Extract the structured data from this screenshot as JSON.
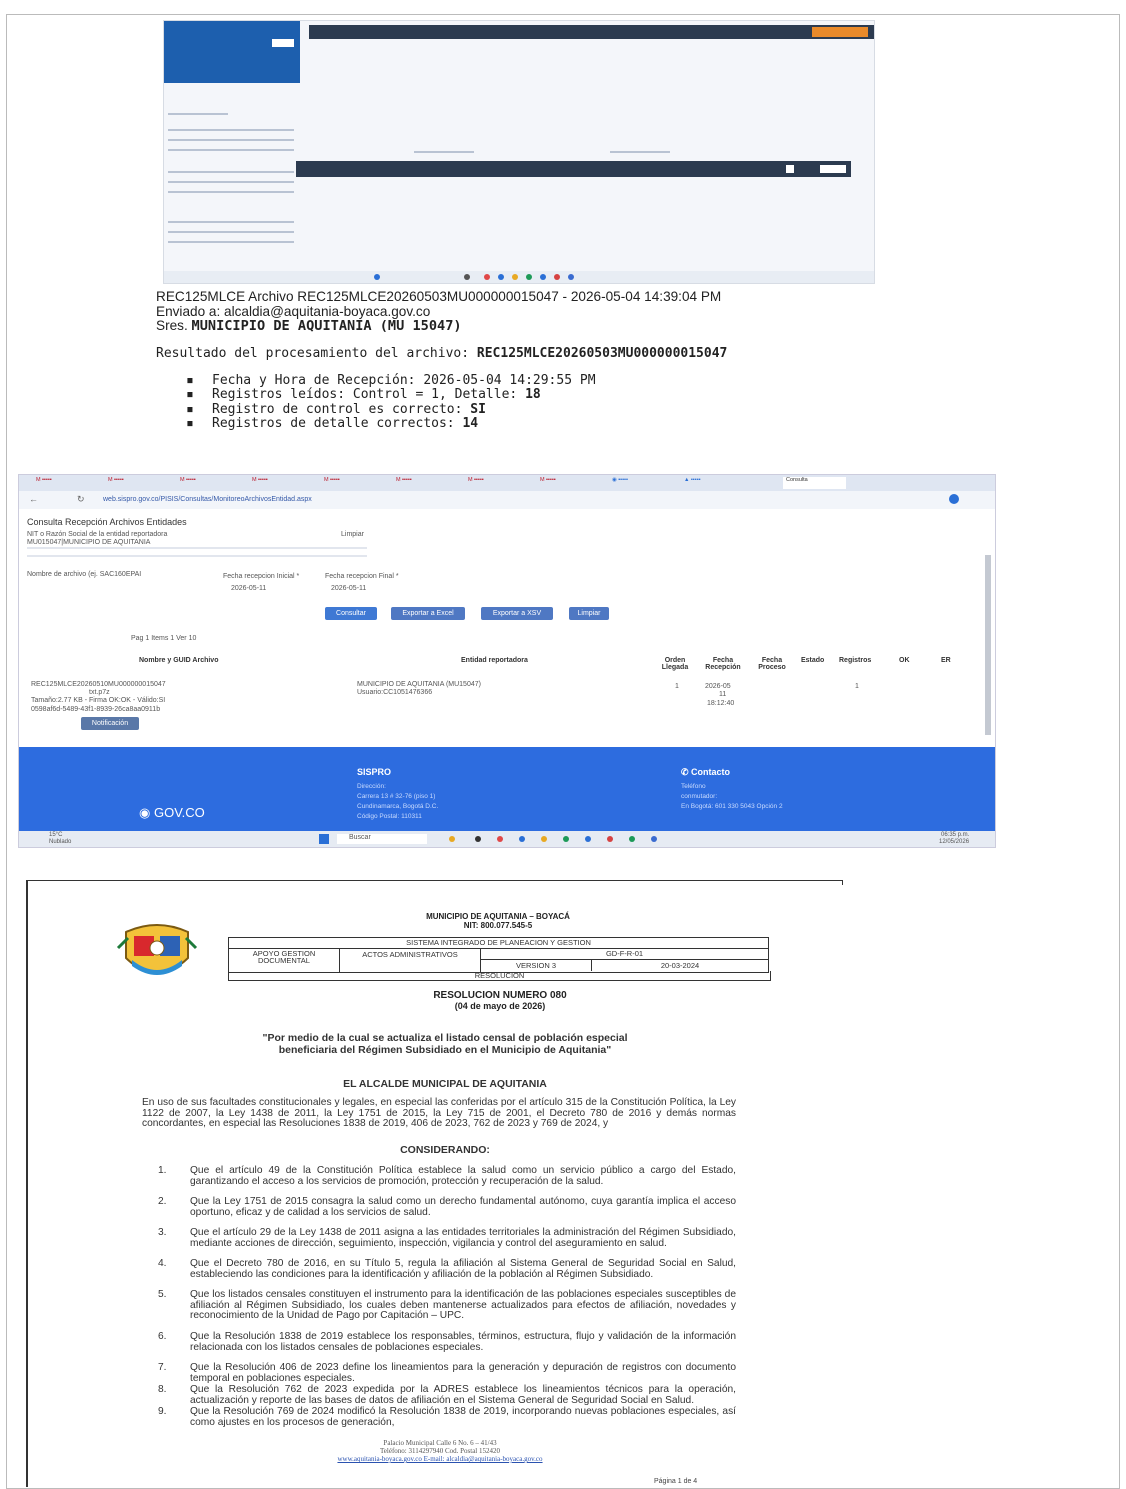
{
  "caption": {
    "line1": "REC125MLCE Archivo REC125MLCE20260503MU000000015047 - 2026-05-04 14:39:04 PM",
    "line2": "Enviado a: alcaldia@aquitania-boyaca.gov.co",
    "sres_label": "Sres.",
    "sres_value": "MUNICIPIO DE AQUITANIA (MU 15047)",
    "result_label": "Resultado del procesamiento del archivo:",
    "result_value": "REC125MLCE20260503MU000000015047",
    "bullets": [
      {
        "label": "Fecha y Hora de Recepción:",
        "value": "2026-05-04 14:29:55 PM"
      },
      {
        "label": "Registros leídos: Control = 1, Detalle:",
        "value": "18"
      },
      {
        "label": "Registro de control es correcto:",
        "value": "SI"
      },
      {
        "label": "Registros de detalle correctos:",
        "value": "14"
      }
    ]
  },
  "portal": {
    "url": "web.sispro.gov.co/PISIS/Consultas/MonitoreoArchivosEntidad.aspx",
    "tab_consulta": "Consulta",
    "title": "Consulta Recepción Archivos Entidades",
    "nit_label": "NIT o Razón Social de la entidad reportadora",
    "nit_value": "MU015047|MUNICIPIO DE AQUITANIA",
    "limpiar_link": "Limpiar",
    "filename_label": "Nombre de archivo (ej. SAC160EPAI",
    "fecha_inicial_label": "Fecha recepcion Inicial *",
    "fecha_final_label": "Fecha recepcion Final *",
    "fecha_inicial": "2026-05-11",
    "fecha_final": "2026-05-11",
    "buttons": {
      "consultar": "Consultar",
      "excel": "Exportar a Excel",
      "xsv": "Exportar a XSV",
      "limpiar": "Limpiar"
    },
    "pager": "Pag  1   Items 1 Ver   10",
    "columns": [
      "Nombre y GUID Archivo",
      "Entidad reportadora",
      "Orden Llegada",
      "Fecha Recepción",
      "Fecha Proceso",
      "Estado",
      "Registros",
      "OK",
      "ER"
    ],
    "row": {
      "file": "REC125MLCE20260510MU000000015047",
      "file_ext": "txt.p7z",
      "size": "Tamaño:2.77 KB - Firma OK:OK - Válido:SI",
      "guid": "0598af6d-5489-43f1-8939-26ca8aa0911b",
      "entity": "MUNICIPIO DE AQUITANIA (MU15047)",
      "user": "Usuario:CC1051476366",
      "order": "1",
      "date": "2026-05",
      "date2": "11",
      "time": "18:12:40",
      "registros": "1",
      "notif_button": "Notificación"
    },
    "footer": {
      "brand": "GOV.CO",
      "sispro": "SISPRO",
      "contacto": "Contacto",
      "dir_label": "Dirección:",
      "dir_value": "Carrera 13 # 32-76 (piso 1)",
      "city": "Cundinamarca, Bogotá D.C.",
      "postal": "Código Postal: 110311",
      "tel_label": "Teléfono",
      "conm": "conmutador:",
      "bog": "En Bogotá: 601 330 5043 Opción 2"
    },
    "weather": "15°C",
    "weather_desc": "Nublado",
    "search": "Buscar",
    "clock_time": "06:35 p.m.",
    "clock_date": "12/05/2026"
  },
  "doc": {
    "municipio": "MUNICIPIO DE AQUITANIA – BOYACÁ",
    "nit": "NIT: 800.077.545-5",
    "sistema": "SISTEMA INTEGRADO DE PLANEACION Y GESTION",
    "cell_apoyo": "APOYO GESTION DOCUMENTAL",
    "cell_actos": "ACTOS ADMINISTRATIVOS",
    "cell_code": "GD-F-R-01",
    "cell_version": "VERSION 3",
    "cell_date": "20-03-2024",
    "cell_resolucion": "RESOLUCION",
    "res_number": "RESOLUCION NUMERO  080",
    "res_date": "(04 de mayo de 2026)",
    "subject1": "\"Por medio de la cual se actualiza el listado censal de población especial",
    "subject2": "beneficiaria del Régimen Subsidiado en el Municipio de Aquitania\"",
    "alcalde": "EL ALCALDE MUNICIPAL DE AQUITANIA",
    "intro": "En uso de sus facultades constitucionales y legales, en especial las conferidas por el artículo 315 de la Constitución Política, la Ley 1122 de 2007, la Ley 1438 de 2011, la Ley 1751 de 2015, la Ley 715 de 2001, el Decreto 780 de 2016 y demás normas concordantes, en especial las Resoluciones 1838 de 2019, 406 de 2023, 762 de 2023 y 769 de 2024, y",
    "considerando": "CONSIDERANDO:",
    "items": [
      {
        "n": "1.",
        "t": "Que el artículo 49 de la Constitución Política establece la salud como un servicio público a cargo del Estado, garantizando el acceso a los servicios de promoción, protección y recuperación de la salud."
      },
      {
        "n": "2.",
        "t": "Que la Ley 1751 de 2015 consagra la salud como un derecho fundamental autónomo, cuya garantía implica el acceso oportuno, eficaz y de calidad a los servicios de salud."
      },
      {
        "n": "3.",
        "t": "Que el artículo 29 de la Ley 1438 de 2011 asigna a las entidades territoriales la administración del Régimen Subsidiado, mediante acciones de dirección, seguimiento, inspección, vigilancia y control del aseguramiento en salud."
      },
      {
        "n": "4.",
        "t": "Que el Decreto 780 de 2016, en su Título 5, regula la afiliación al Sistema General de Seguridad Social en Salud, estableciendo las condiciones para la identificación y afiliación de la población al Régimen Subsidiado."
      },
      {
        "n": "5.",
        "t": "Que los listados censales constituyen el instrumento para la identificación de las poblaciones especiales susceptibles de afiliación al Régimen Subsidiado, los cuales deben mantenerse actualizados para efectos de afiliación, novedades y reconocimiento de la Unidad de Pago por Capitación – UPC."
      },
      {
        "n": "6.",
        "t": "Que la Resolución 1838 de 2019 establece los responsables, términos, estructura, flujo y validación de la información relacionada con los listados censales de poblaciones especiales."
      },
      {
        "n": "7.",
        "t": "Que la Resolución 406 de 2023 define los lineamientos para la generación y depuración de registros con documento temporal en poblaciones especiales."
      },
      {
        "n": "8.",
        "t": "Que la Resolución 762 de 2023 expedida por la ADRES establece los lineamientos técnicos para la operación, actualización y reporte de las bases de datos de afiliación en el Sistema General de Seguridad Social en Salud."
      },
      {
        "n": "9.",
        "t": "Que la Resolución 769 de 2024 modificó la Resolución 1838 de 2019, incorporando nuevas poblaciones especiales, así como ajustes en los procesos de generación,"
      }
    ],
    "footer1": "Palacio Municipal Calle 6 No. 6 – 41/43",
    "footer2": "Teléfono: 3114297940 Cod. Postal 152420",
    "footer3": "www.aquitania-boyaca.gov.co  E-mail: alcaldia@aquitania-boyaca.gov.co",
    "page": "Página 1 de 4"
  }
}
